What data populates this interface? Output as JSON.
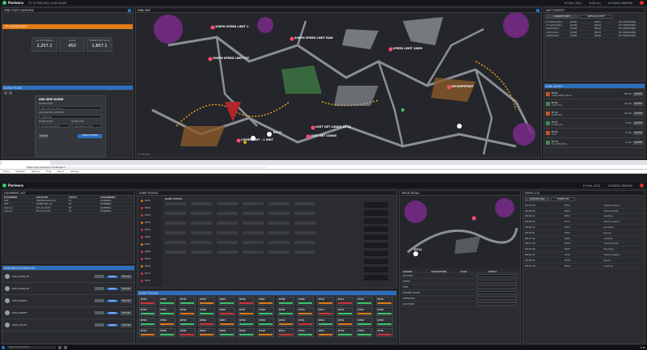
{
  "app": {
    "brand": "Parleera",
    "user": "LOGGED LAWSON",
    "top_time": "8:30 am",
    "top_date": "19 Feb, 2021",
    "top_meta": "TY 19 FEB 2021 5:00:00 AM"
  },
  "top_left": {
    "title": "MINE STATE OVERVIEW",
    "banner": "TY 19 FEB 2021",
    "kpis": [
      {
        "label": "MILLED TONNES",
        "value": "2,257.1"
      },
      {
        "label": "LOADS",
        "value": "450"
      },
      {
        "label": "TONNES PER HOUR",
        "value": "1,807.1"
      }
    ]
  },
  "blend_panel": {
    "title": "BLEND PLANS",
    "subtitle": "ADD NEW BLEND",
    "fields": [
      {
        "label": "BLEND NAME",
        "value": "BLD_FEB_19_2021_A"
      },
      {
        "label": "DESTINATION CRUSHER",
        "value": "CRUSHER"
      },
      {
        "label": "BLEND START",
        "value": "19/02/2021 08:30"
      },
      {
        "label": "BLEND END",
        "value": "19/02/2021 20:30"
      }
    ],
    "cancel": "CANCEL",
    "submit": "CREATE BLEND"
  },
  "mine_map": {
    "title": "MINE MAP",
    "labels": [
      {
        "text": "20KPH SPEED LIMIT 1"
      },
      {
        "text": "30KPH SPEED LIMIT RAM"
      },
      {
        "text": "30KPH SPEED LIMIT PIT"
      },
      {
        "text": "SPEED LIMIT 10KM"
      },
      {
        "text": "INCOMPETENT"
      },
      {
        "text": "LOST GET LOADS 25 11"
      },
      {
        "text": "LOST GET LOADS"
      },
      {
        "text": "COMPETENT - 1 UNIT"
      },
      {
        "text": "EX 01"
      }
    ],
    "footer": "19 FEB 2021"
  },
  "shift_panel": {
    "title": "SHIFT EVENTS",
    "tabs": [
      "CURRENT SHIFT",
      "PREVIOUS SHIFT"
    ],
    "rows": [
      [
        "TY:19/02/2021",
        "DUMP",
        "MD01",
        "PIT OPERATING"
      ],
      [
        "TY:19/02/2021",
        "DUMP",
        "MD01",
        "PIT OPERATING"
      ],
      [
        "19/02/2021",
        "DUMP",
        "MD03",
        "PIT OPERATING"
      ],
      [
        "19/02/2021",
        "DUMP",
        "MD03",
        "PIT OPERATING"
      ],
      [
        "19/02/2021",
        "DUMP",
        "MD04",
        "PIT OPERATING"
      ]
    ]
  },
  "notifications": {
    "title": "MINE ALERTS",
    "items": [
      {
        "name": "EX 01",
        "detail": "UNPLANNED DELAY",
        "time": "58 min"
      },
      {
        "name": "EX 04",
        "detail": "LOW FUEL",
        "time": "22 min"
      },
      {
        "name": "DT 11",
        "detail": "SPEEDING",
        "time": "15 min"
      },
      {
        "name": "DT 07",
        "detail": "OVERLOAD",
        "time": "8 min"
      },
      {
        "name": "EX 02",
        "detail": "IDLE",
        "time": "6 min"
      },
      {
        "name": "DT 03",
        "detail": "NO OPERATOR",
        "time": "2 min"
      }
    ],
    "action": "ACCEPT"
  },
  "browser": {
    "url": "https://app.parleera.com/dispatch",
    "bookmarks": [
      "Home",
      "Dispatch",
      "Reports",
      "Fleet",
      "Blend",
      "Settings"
    ]
  },
  "bottom_topbar": {
    "brand": "Parleera",
    "date": "19 Feb, 2021",
    "user": "LOGGED LAWSON"
  },
  "equipment_panel": {
    "title": "EQUIPMENT LIST",
    "cols": [
      "EQUIPMENT",
      "LOCATION",
      "STATUS",
      "ASSIGNMENT"
    ],
    "rows": [
      [
        "SFR",
        "VENTED-RULE 01",
        "PIT",
        "RUNNING"
      ],
      [
        "SFR",
        "DUMP-SFR_01",
        "PIT",
        "RUNNING"
      ],
      [
        "Sullivan",
        "PIT_01_FACE",
        "PIT",
        "RUNNING"
      ],
      [
        "Sullivan",
        "PIT_02_FACE",
        "PIT",
        "RUNNING"
      ]
    ]
  },
  "loaders_panel": {
    "title": "ASSIGNED EXCAVATORS",
    "items": [
      "EX01_MAIN_PIT",
      "EX02_MAIN_PIT",
      "EX03_NORTH",
      "EX04_NORTH",
      "EX05_SOUTH"
    ],
    "btn_a": "SPEED",
    "btn_b": "TRUCKS"
  },
  "dump_panel": {
    "title": "DUMP TRUCKS",
    "header": "DUMP STATUS",
    "truck_ids": [
      "DT01",
      "DT02",
      "DT03",
      "DT04",
      "DT05",
      "DT06",
      "DT07",
      "DT08",
      "DT09",
      "DT10",
      "DT11",
      "DT12"
    ]
  },
  "truck_detail": {
    "title": "TRUCK DETAIL",
    "truck": "DT11",
    "cols": [
      "SOURCE",
      "DESTINATION",
      "CYCLE",
      "STATUS"
    ],
    "fields": [
      "PAYLOAD",
      "SPEED",
      "FUEL",
      "ENGINE HOURS",
      "OPERATOR",
      "LOCATION"
    ]
  },
  "log_panel": {
    "title": "EVENT LOG",
    "tabs": [
      "ACTIVITY LOG",
      "TONNE LOG"
    ],
    "rows": [
      [
        "08:29:58",
        "DT01",
        "Travel Loaded"
      ],
      [
        "08:29:40",
        "DT04",
        "Travel Empty"
      ],
      [
        "08:29:11",
        "EX01",
        "Loading"
      ],
      [
        "08:28:52",
        "DT11",
        "Travel Loaded"
      ],
      [
        "08:28:34",
        "DT07",
        "Dumping"
      ],
      [
        "08:28:01",
        "DT02",
        "Queue"
      ],
      [
        "08:27:44",
        "EX03",
        "Loading"
      ],
      [
        "08:27:20",
        "DT09",
        "Travel Empty"
      ],
      [
        "08:26:58",
        "DT05",
        "Dumping"
      ],
      [
        "08:26:31",
        "DT12",
        "Travel Loaded"
      ],
      [
        "08:26:02",
        "DT08",
        "Queue"
      ],
      [
        "08:25:40",
        "EX02",
        "Loading"
      ]
    ]
  },
  "taskbar": {
    "search": "Type here to search",
    "time": "8:30"
  }
}
